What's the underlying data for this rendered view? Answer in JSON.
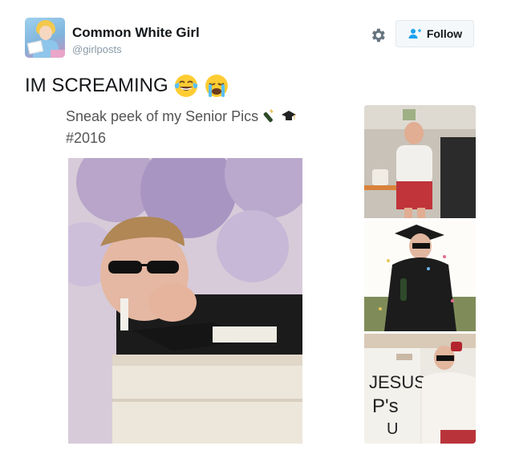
{
  "user": {
    "name": "Common White Girl",
    "handle": "@girlposts"
  },
  "follow_button": {
    "label": "Follow",
    "icon": "add-user-icon"
  },
  "settings": {
    "icon": "gear-icon"
  },
  "tweet": {
    "text": "IM SCREAMING",
    "emojis": [
      "tears-of-joy-emoji",
      "loudly-crying-emoji"
    ]
  },
  "media": {
    "caption_line1": "Sneak peek of my Senior Pics",
    "caption_emojis": [
      "champagne-bottle-emoji",
      "graduation-cap-emoji"
    ],
    "caption_line2": "#2016",
    "images": [
      "main-photo",
      "thumbnail-1",
      "thumbnail-2",
      "thumbnail-3"
    ]
  },
  "colors": {
    "text": "#14171a",
    "secondary": "#8899a6",
    "follow_icon": "#1da1f2"
  }
}
